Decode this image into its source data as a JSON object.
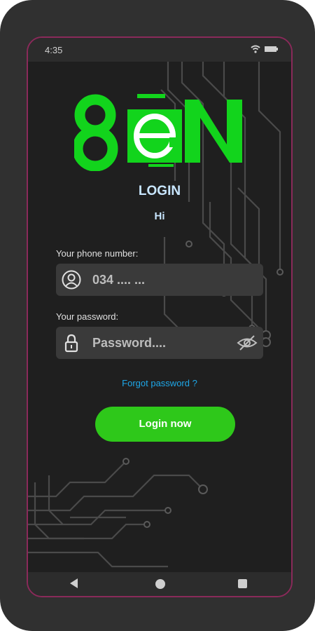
{
  "status_bar": {
    "time": "4:35"
  },
  "brand": {
    "logo_text": "8eN",
    "accent": "#12d41c"
  },
  "header": {
    "title": "LOGIN",
    "subtitle": "Hi"
  },
  "phone": {
    "label": "Your phone number:",
    "value": "034 .... ..."
  },
  "password": {
    "label": "Your password:",
    "placeholder": "Password...."
  },
  "links": {
    "forgot": "Forgot password ?"
  },
  "actions": {
    "login_label": "Login now"
  },
  "icons": {
    "phone": "user-icon",
    "password": "lock-icon",
    "visibility": "eye-off-icon",
    "nav_back": "back-icon",
    "nav_home": "home-icon",
    "nav_recent": "recent-apps-icon"
  },
  "colors": {
    "button": "#2ec81a",
    "link": "#1ea7e8",
    "title": "#c8e6ff"
  }
}
